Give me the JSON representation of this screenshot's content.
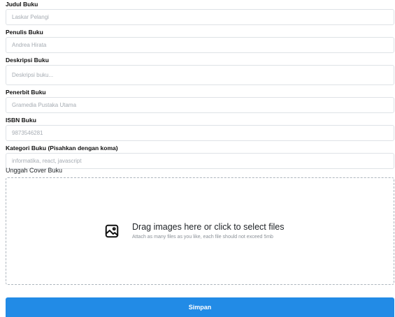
{
  "fields": {
    "judul": {
      "label": "Judul Buku",
      "placeholder": "Laskar Pelangi",
      "value": ""
    },
    "penulis": {
      "label": "Penulis Buku",
      "placeholder": "Andrea Hirata",
      "value": ""
    },
    "deskripsi": {
      "label": "Deskripsi Buku",
      "placeholder": "Deskripsi buku...",
      "value": ""
    },
    "penerbit": {
      "label": "Penerbit Buku",
      "placeholder": "Gramedia Pustaka Utama",
      "value": ""
    },
    "isbn": {
      "label": "ISBN Buku",
      "placeholder": "9873546281",
      "value": ""
    },
    "kategori": {
      "label": "Kategori Buku (Pisahkan dengan koma)",
      "placeholder": "informatika, react, javascript",
      "value": ""
    }
  },
  "upload": {
    "label": "Unggah Cover Buku",
    "title": "Drag images here or click to select files",
    "subtitle": "Attach as many files as you like, each file should not exceed 5mb",
    "icon": "image-icon"
  },
  "submit": {
    "label": "Simpan",
    "color": "#228be6"
  }
}
